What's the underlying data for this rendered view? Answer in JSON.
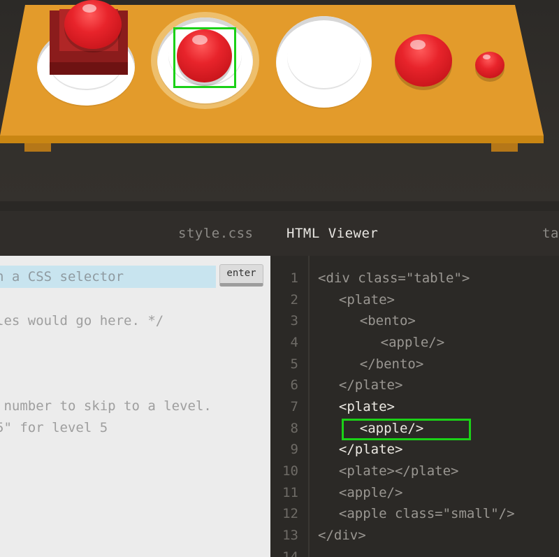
{
  "tabs": {
    "css": "style.css",
    "viewer": "HTML Viewer",
    "third": "ta"
  },
  "css_editor": {
    "input_placeholder": "n a CSS selector",
    "enter_label": "enter",
    "lines": [
      "les would go here. */",
      " number to skip to a level.",
      "5\" for level 5"
    ]
  },
  "html_viewer": {
    "line_numbers": [
      "1",
      "2",
      "3",
      "4",
      "5",
      "6",
      "7",
      "8",
      "9",
      "10",
      "11",
      "12",
      "13",
      "14"
    ],
    "lines": [
      "<div class=\"table\">",
      "  <plate>",
      "    <bento>",
      "      <apple/>",
      "    </bento>",
      "  </plate>",
      "  <plate>",
      "    <apple/>",
      "  </plate>",
      "  <plate></plate>",
      "  <apple/>",
      "  <apple class=\"small\"/>",
      "</div>",
      ""
    ]
  },
  "colors": {
    "table": "#e39b2b",
    "apple": "#e8242b",
    "target_outline": "#1bd117",
    "bento": "#8e1e1e",
    "input_bg": "#c8e4ef"
  },
  "icons": [
    "plate-icon",
    "apple-icon",
    "bento-icon"
  ]
}
